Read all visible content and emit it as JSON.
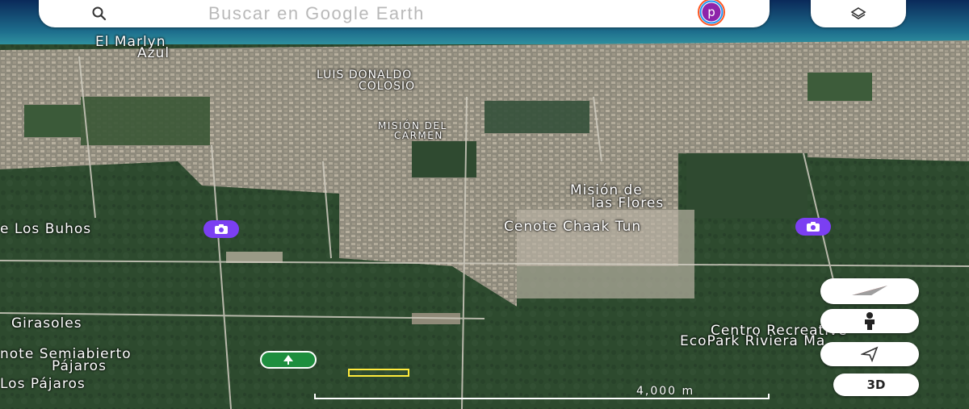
{
  "search": {
    "placeholder": "Buscar en Google Earth",
    "profile_initial": "p"
  },
  "places": [
    {
      "id": "el-marlyn",
      "text": "El Marlyn"
    },
    {
      "id": "azul",
      "text": "Azul"
    },
    {
      "id": "luis-donaldo",
      "text": "LUIS DONALDO"
    },
    {
      "id": "colosio",
      "text": "COLOSIO"
    },
    {
      "id": "mision-del",
      "text": "MISIÓN DEL"
    },
    {
      "id": "carmen",
      "text": "CARMEN"
    },
    {
      "id": "mision-de",
      "text": "Misión de"
    },
    {
      "id": "las-flores",
      "text": "las Flores"
    },
    {
      "id": "los-buhos",
      "text": "e Los Buhos"
    },
    {
      "id": "cenote-chaak-tun",
      "text": "Cenote Chaak Tun"
    },
    {
      "id": "girasoles",
      "text": "Girasoles"
    },
    {
      "id": "cenote-semiabierto",
      "text": "note Semiabierto"
    },
    {
      "id": "pajaros",
      "text": "Pájaros"
    },
    {
      "id": "los-pajaros",
      "text": "Los Pájaros"
    },
    {
      "id": "centro-recreativo",
      "text": "Centro Recreative"
    },
    {
      "id": "ecopark",
      "text": "EcoPark Riviera Ma"
    }
  ],
  "scale": {
    "label": "4,000  m"
  },
  "controls": {
    "three_d_label": "3D"
  },
  "icons": {
    "search": "search-icon",
    "layers": "layers-icon",
    "compass": "compass-icon",
    "pegman": "pegman-icon",
    "my_location": "my-location-icon",
    "photo_poi": "camera-icon",
    "park_poi": "tree-icon"
  },
  "colors": {
    "poi_photo": "#7b3ff2",
    "poi_park": "#1e8e3e",
    "profile_ring_accent": "#ff5722",
    "highlight_box": "#ffeb3b"
  }
}
